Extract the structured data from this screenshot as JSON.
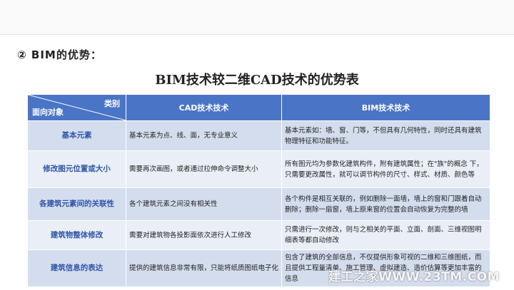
{
  "section_heading": "② BIM的优势：",
  "table_title": "BIM技术较二维CAD技术的优势表",
  "table": {
    "corner_top": "类别",
    "corner_bottom": "面向对象",
    "col_cad": "CAD技术技术",
    "col_bim": "BIM技术技术",
    "rows": [
      {
        "label": "基本元素",
        "cad": "基本元素为点、线、面，无专业意义",
        "bim": "基本元素如：墙、窗、门等，不但具有几何特性，同时还具有建筑物理特征和功能特征。"
      },
      {
        "label": "修改图元位置或大小",
        "cad": "需要再次画图，或者通过拉伸命令调整大小",
        "bim": "所有图元均为参数化建筑构件，附有建筑属性；在\"族\"的概念 下，只需要更改属性，就可以调节构件的尺寸、样式、材质、颜色等"
      },
      {
        "label": "各建筑元素间的关联性",
        "cad": "各个建筑元素之间没有相关性",
        "bim": "各个构件是相互关联的，例如删除一面墙，墙上的窗和门跟着自动删除；删除一扇窗，墙上原来窗的位置会自动恢复为完整的墙"
      },
      {
        "label": "建筑物整体修改",
        "cad": "需要对建筑物各投影面依次进行人工修改",
        "bim": "只需进行一次修改，则与之相关的平面、立面、剖面、三维视图明细表等都自动修改"
      },
      {
        "label": "建筑信息的表达",
        "cad": "提供的建筑信息非常有限，只能将纸质图纸电子化",
        "bim": "包含了建筑的全部信息，不仅提供形象可视的二维和三维图纸，而且提供工程量清单、施工管理、虚拟建造、造价估算等更加丰富的信息"
      }
    ]
  },
  "watermark": "建工之家WWW.23TM.COM"
}
